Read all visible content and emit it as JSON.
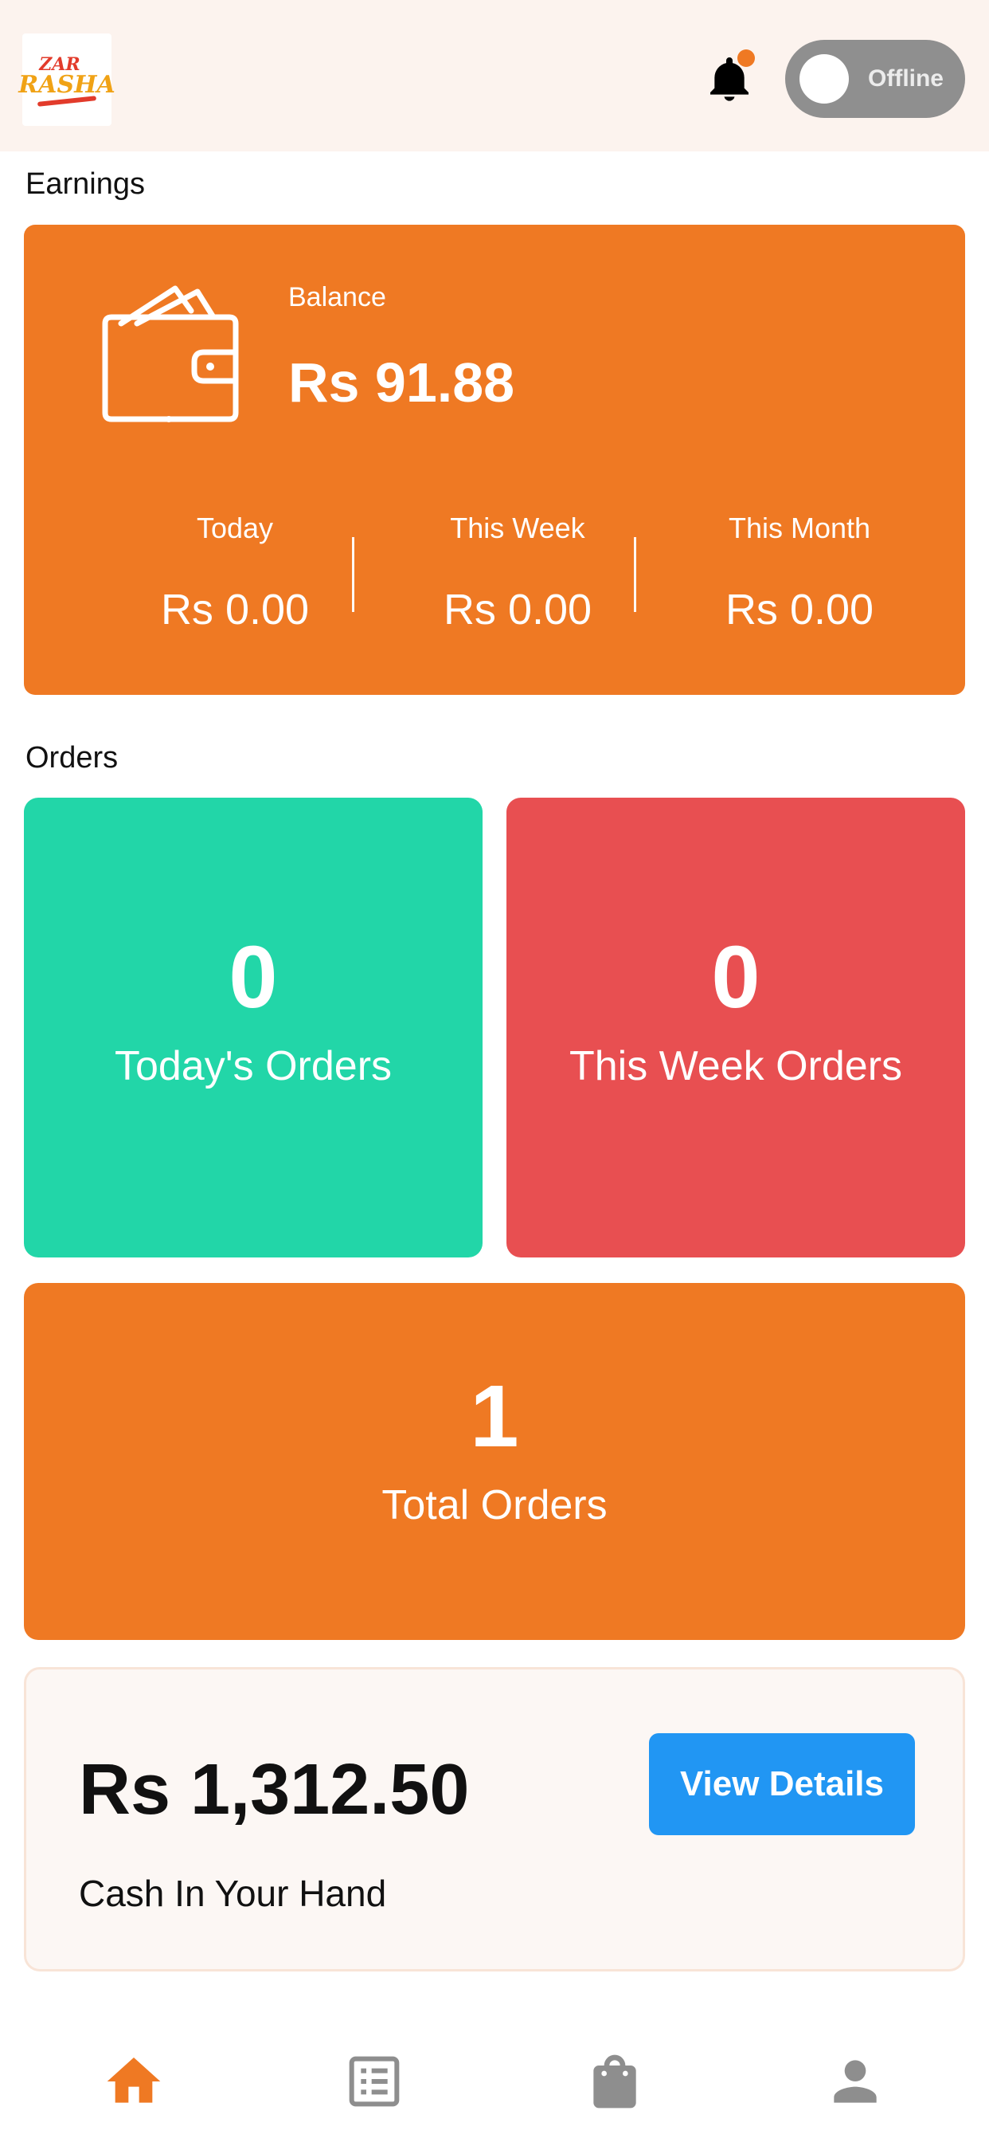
{
  "header": {
    "logo_top": "ZAR",
    "logo_bottom": "RASHA",
    "status_label": "Offline",
    "has_notification": true
  },
  "earnings": {
    "section_title": "Earnings",
    "balance_label": "Balance",
    "balance_value": "Rs 91.88",
    "periods": [
      {
        "label": "Today",
        "value": "Rs 0.00"
      },
      {
        "label": "This Week",
        "value": "Rs 0.00"
      },
      {
        "label": "This Month",
        "value": "Rs 0.00"
      }
    ]
  },
  "orders": {
    "section_title": "Orders",
    "today": {
      "count": "0",
      "label": "Today's Orders"
    },
    "week": {
      "count": "0",
      "label": "This Week Orders"
    },
    "total": {
      "count": "1",
      "label": "Total Orders"
    }
  },
  "cash": {
    "value": "Rs 1,312.50",
    "label": "Cash In Your Hand",
    "button_label": "View Details"
  },
  "nav": {
    "items": [
      "home-icon",
      "orders-list-icon",
      "shopping-bag-icon",
      "profile-icon"
    ],
    "active_index": 0
  },
  "colors": {
    "accent": "#ef7923",
    "teal": "#22d6a8",
    "red": "#e84f51",
    "blue": "#2196f3",
    "inactive_icon": "#8e8e8e"
  }
}
